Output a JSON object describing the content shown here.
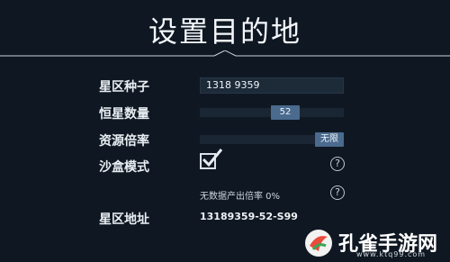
{
  "page": {
    "title": "设置目的地"
  },
  "settings": {
    "seed": {
      "label": "星区种子",
      "value": "1318 9359"
    },
    "star_count": {
      "label": "恒星数量",
      "value": "52",
      "level": 0.62
    },
    "resource_multiplier": {
      "label": "资源倍率",
      "value": "无限",
      "level": 1.0
    },
    "sandbox": {
      "label": "沙盒模式",
      "checked": true
    },
    "note": "无数据产出倍率 0%",
    "address": {
      "label": "星区地址",
      "value": "13189359-52-S99"
    }
  },
  "watermark": {
    "text": "孔雀手游网",
    "url": "www.ktq99.com"
  },
  "colors": {
    "background": "#0f1822",
    "handle": "#4a6a8e",
    "track": "#1a2633"
  }
}
